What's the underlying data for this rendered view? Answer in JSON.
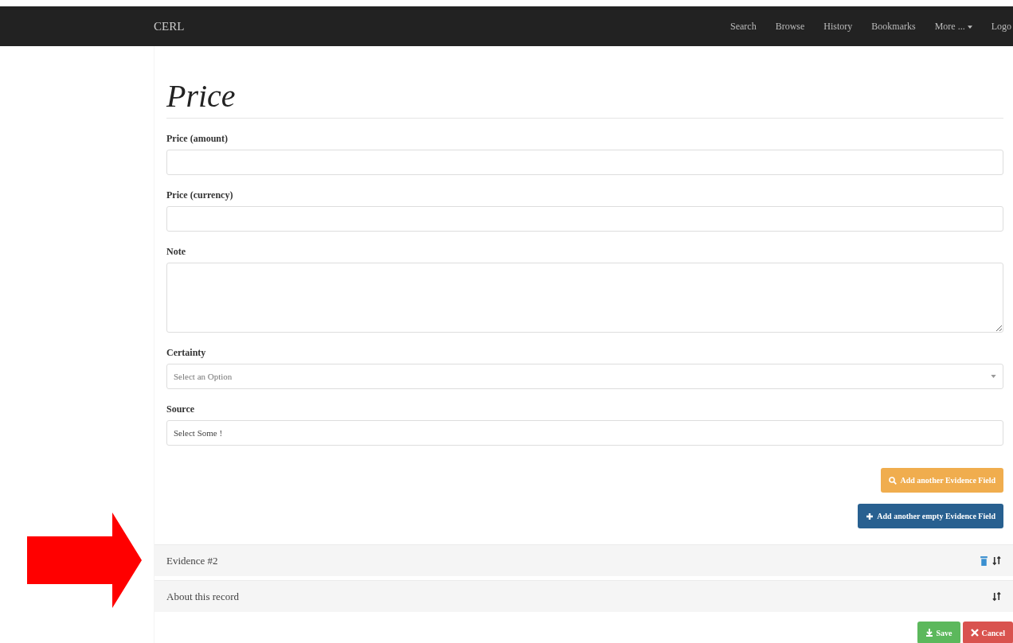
{
  "navbar": {
    "brand": "CERL",
    "links": [
      {
        "label": "Search",
        "kind": "link"
      },
      {
        "label": "Browse",
        "kind": "link"
      },
      {
        "label": "History",
        "kind": "link"
      },
      {
        "label": "Bookmarks",
        "kind": "link"
      },
      {
        "label": "More ...",
        "kind": "dropdown"
      },
      {
        "label": "Logo",
        "kind": "link"
      }
    ]
  },
  "form": {
    "title": "Price",
    "fields": [
      {
        "label": "Price (amount)",
        "kind": "text"
      },
      {
        "label": "Price (currency)",
        "kind": "text"
      },
      {
        "label": "Note",
        "kind": "textarea"
      },
      {
        "label": "Certainty",
        "kind": "select",
        "placeholder": "Select an Option"
      },
      {
        "label": "Source",
        "kind": "multiselect",
        "placeholder": "Select Some !"
      }
    ],
    "buttons": [
      {
        "label": "Add another Evidence Field",
        "kind": "search"
      },
      {
        "label": "Add another empty Evidence Field",
        "kind": "add"
      }
    ]
  },
  "panels": [
    {
      "title": "Evidence #2",
      "deletable": true
    },
    {
      "title": "About this record",
      "deletable": false
    }
  ],
  "actions": [
    {
      "label": "Save",
      "kind": "save"
    },
    {
      "label": "Cancel",
      "kind": "cancel"
    }
  ]
}
